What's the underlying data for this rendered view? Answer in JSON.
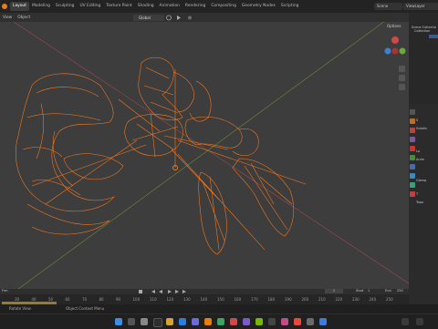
{
  "workspace_tabs": [
    "Layout",
    "Modeling",
    "Sculpting",
    "UV Editing",
    "Texture Paint",
    "Shading",
    "Animation",
    "Rendering",
    "Compositing",
    "Geometry Nodes",
    "Scripting"
  ],
  "active_tab": "Layout",
  "scene": "Scene",
  "view_layer": "ViewLayer",
  "header": {
    "view": "View",
    "object": "Object",
    "orientation": "Global",
    "options": "Options"
  },
  "outliner": {
    "items": [
      "Scene Collection",
      "Collection"
    ]
  },
  "timeline": {
    "start_marker": "Frm",
    "frame_ticks": [
      "30",
      "40",
      "50",
      "60",
      "70",
      "80",
      "90",
      "100",
      "110",
      "120",
      "130",
      "140",
      "150",
      "160",
      "170",
      "180",
      "190",
      "200",
      "210",
      "220",
      "230",
      "240",
      "250"
    ],
    "current_frame": "1",
    "start_label": "Start",
    "start_value": "1",
    "end_label": "End",
    "end_value": "250"
  },
  "status": {
    "rotate_view": "Rotate View",
    "context_menu": "Object Context Menu"
  },
  "properties": {
    "labels": [
      "S",
      "Subdiv",
      "Lo",
      "Anim",
      "Clamp",
      "T",
      "Topo"
    ]
  },
  "colors": {
    "accent": "#e87d0d",
    "wire": "#ff7b1c",
    "viewport_bg": "#3d3d3d"
  }
}
